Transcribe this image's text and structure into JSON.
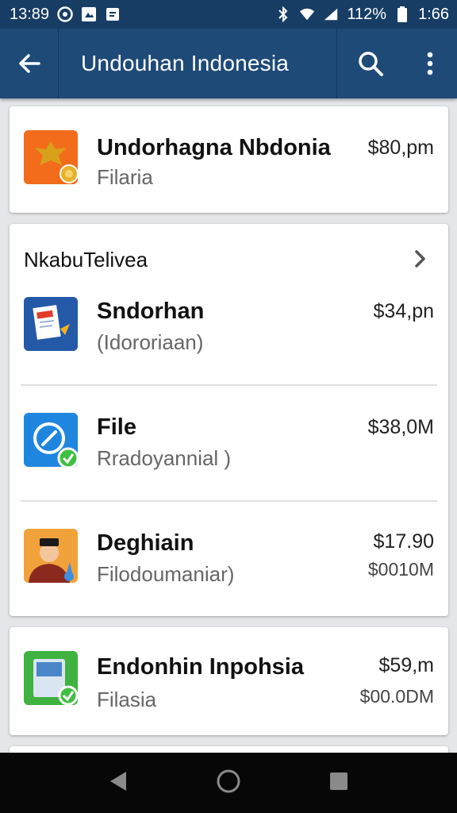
{
  "status_bar": {
    "time_left": "13:89",
    "battery": "112%",
    "time_right": "1:66"
  },
  "app_bar": {
    "title": "Undouhan Indonesia",
    "icons": [
      "back-arrow-icon",
      "search-icon",
      "more-vert-icon"
    ]
  },
  "featured": {
    "name": "Undorhagna Nbdonia",
    "subtitle": "Filaria",
    "price": "$80,pm"
  },
  "section": {
    "title": "NkabuTelivea",
    "items": [
      {
        "name": "Sndorhan",
        "subtitle": "(Idororiaan)",
        "price": "$34,pn",
        "price_secondary": ""
      },
      {
        "name": "File",
        "subtitle": "Rradoyannial )",
        "price": "$38,0M",
        "price_secondary": ""
      },
      {
        "name": "Deghiain",
        "subtitle": "Filodoumaniar)",
        "price": "$17.90",
        "price_secondary": "$0010M"
      }
    ]
  },
  "bottom_item": {
    "name": "Endonhin Inpohsia",
    "subtitle": "Filasia",
    "price": "$59,m",
    "price_secondary": "$00.0DM"
  },
  "nav_bar": {
    "icons": [
      "back-triangle-icon",
      "home-circle-icon",
      "recents-square-icon"
    ]
  },
  "colors": {
    "status_bar": "#173d64",
    "app_bar": "#1e4a78",
    "background": "#e4e6e9",
    "nav_bar": "#070707"
  }
}
